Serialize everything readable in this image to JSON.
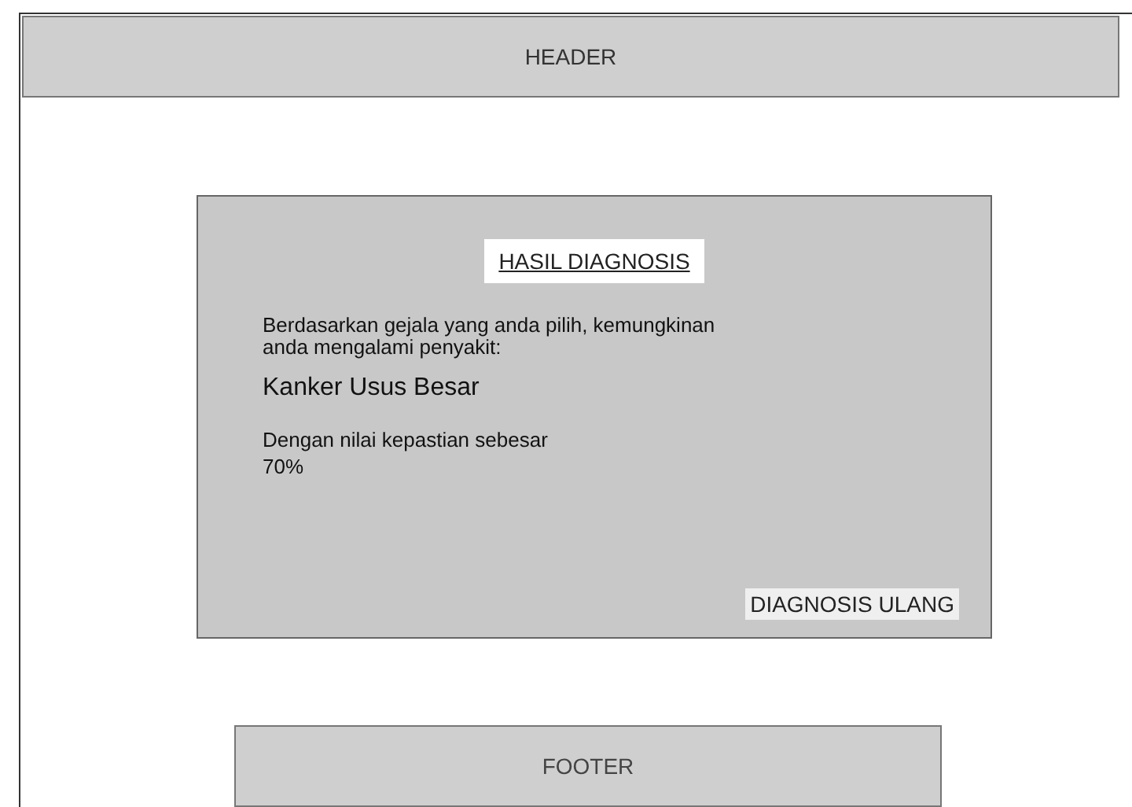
{
  "header": {
    "label": "HEADER"
  },
  "result": {
    "title": "HASIL DIAGNOSIS",
    "intro": "Berdasarkan gejala yang anda pilih, kemungkinan anda mengalami penyakit:",
    "disease": "Kanker Usus Besar",
    "certainty_label": "Dengan nilai kepastian sebesar",
    "certainty_value": "70%",
    "button": "DIAGNOSIS ULANG"
  },
  "footer": {
    "label": "FOOTER"
  }
}
